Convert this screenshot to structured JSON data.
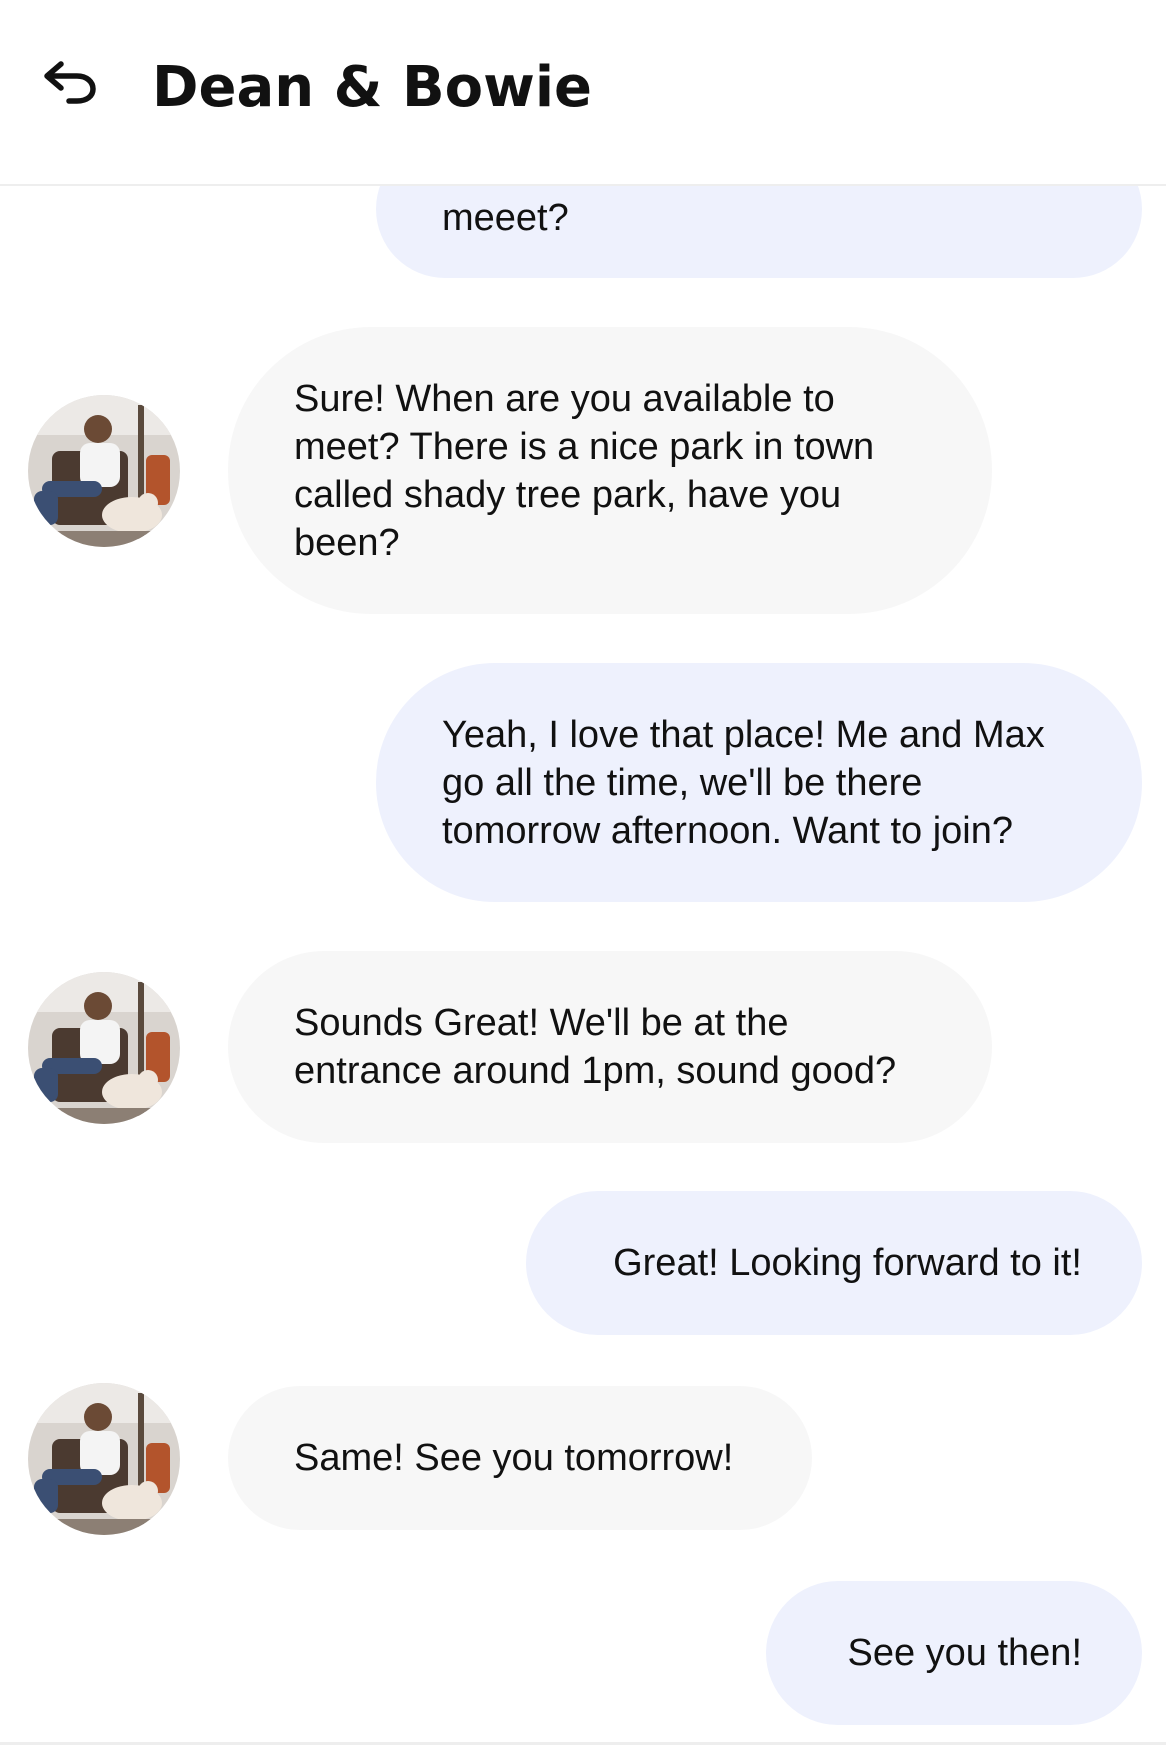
{
  "header": {
    "back_icon": "back-arrow-icon",
    "title": "Dean & Bowie"
  },
  "messages": [
    {
      "direction": "outgoing",
      "text": "meeet?"
    },
    {
      "direction": "incoming",
      "text": "Sure! When are you available to meet? There is a nice park in town called shady tree park, have you been?"
    },
    {
      "direction": "outgoing",
      "text": "Yeah, I love that place! Me and Max go all the time, we'll be there tomorrow afternoon. Want to join?"
    },
    {
      "direction": "incoming",
      "text": "Sounds Great! We'll be at the entrance around 1pm, sound good?"
    },
    {
      "direction": "outgoing",
      "text": "Great! Looking forward to it!"
    },
    {
      "direction": "incoming",
      "text": "Same! See you tomorrow!"
    },
    {
      "direction": "outgoing",
      "text": "See you then!"
    }
  ],
  "colors": {
    "outgoing_bubble": "#eef1fd",
    "incoming_bubble": "#f7f7f7",
    "text": "#111111",
    "background": "#ffffff"
  },
  "avatar": {
    "icon": "contact-avatar-photo"
  }
}
